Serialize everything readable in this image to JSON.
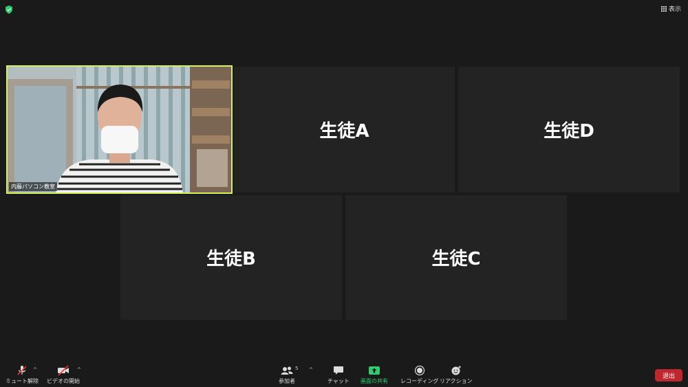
{
  "top": {
    "view_label": "表示"
  },
  "tiles": {
    "self_name": "内藤パソコン教室",
    "student_a": "生徒A",
    "student_d": "生徒D",
    "student_b": "生徒B",
    "student_c": "生徒C"
  },
  "toolbar": {
    "mute_label": "ミュート解除",
    "video_label": "ビデオの開始",
    "participants_label": "参加者",
    "participants_count": "5",
    "chat_label": "チャット",
    "share_label": "画面の共有",
    "record_label": "レコーディング",
    "reactions_label": "リアクション",
    "leave_label": "退出"
  },
  "colors": {
    "background": "#1a1a1a",
    "tile": "#232323",
    "active_speaker_border": "#d3f25e",
    "share_green": "#2ecc71",
    "leave_red": "#c0262d"
  }
}
